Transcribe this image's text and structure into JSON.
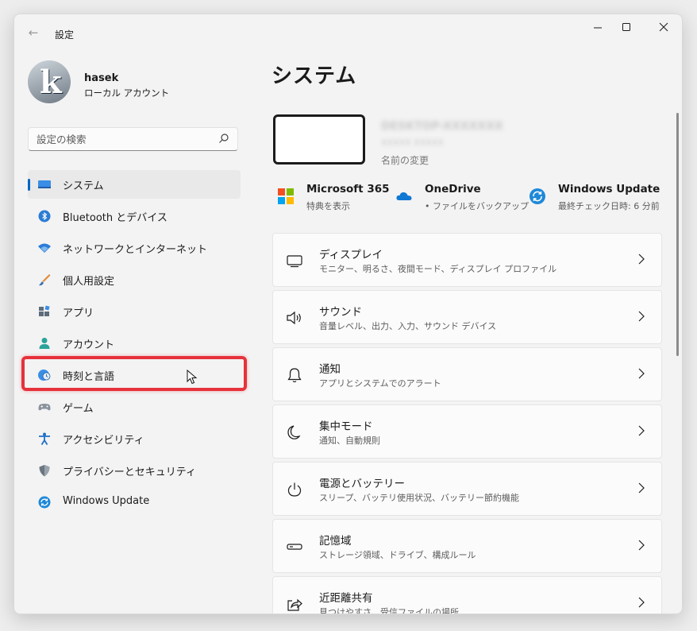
{
  "window": {
    "title": "設定"
  },
  "profile": {
    "name": "hasek",
    "account_type": "ローカル アカウント"
  },
  "search": {
    "placeholder": "設定の検索"
  },
  "nav": {
    "items": [
      {
        "label": "システム"
      },
      {
        "label": "Bluetooth とデバイス"
      },
      {
        "label": "ネットワークとインターネット"
      },
      {
        "label": "個人用設定"
      },
      {
        "label": "アプリ"
      },
      {
        "label": "アカウント"
      },
      {
        "label": "時刻と言語"
      },
      {
        "label": "ゲーム"
      },
      {
        "label": "アクセシビリティ"
      },
      {
        "label": "プライバシーとセキュリティ"
      },
      {
        "label": "Windows Update"
      }
    ]
  },
  "main": {
    "title": "システム",
    "device": {
      "name": "DESKTOP-XXXXXXX",
      "model": "XXXXX XXXXX",
      "rename": "名前の変更"
    },
    "quick": [
      {
        "title": "Microsoft 365",
        "sub": "特典を表示"
      },
      {
        "title": "OneDrive",
        "sub": "• ファイルをバックアップ"
      },
      {
        "title": "Windows Update",
        "sub": "最終チェック日時: 6 分前"
      }
    ],
    "cards": [
      {
        "title": "ディスプレイ",
        "sub": "モニター、明るさ、夜間モード、ディスプレイ プロファイル"
      },
      {
        "title": "サウンド",
        "sub": "音量レベル、出力、入力、サウンド デバイス"
      },
      {
        "title": "通知",
        "sub": "アプリとシステムでのアラート"
      },
      {
        "title": "集中モード",
        "sub": "通知、自動規則"
      },
      {
        "title": "電源とバッテリー",
        "sub": "スリープ、バッテリ使用状況、バッテリー節約機能"
      },
      {
        "title": "記憶域",
        "sub": "ストレージ領域、ドライブ、構成ルール"
      },
      {
        "title": "近距離共有",
        "sub": "見つけやすさ、受信ファイルの場所"
      }
    ]
  },
  "colors": {
    "accent": "#0067c0",
    "highlight": "#e6323c"
  }
}
